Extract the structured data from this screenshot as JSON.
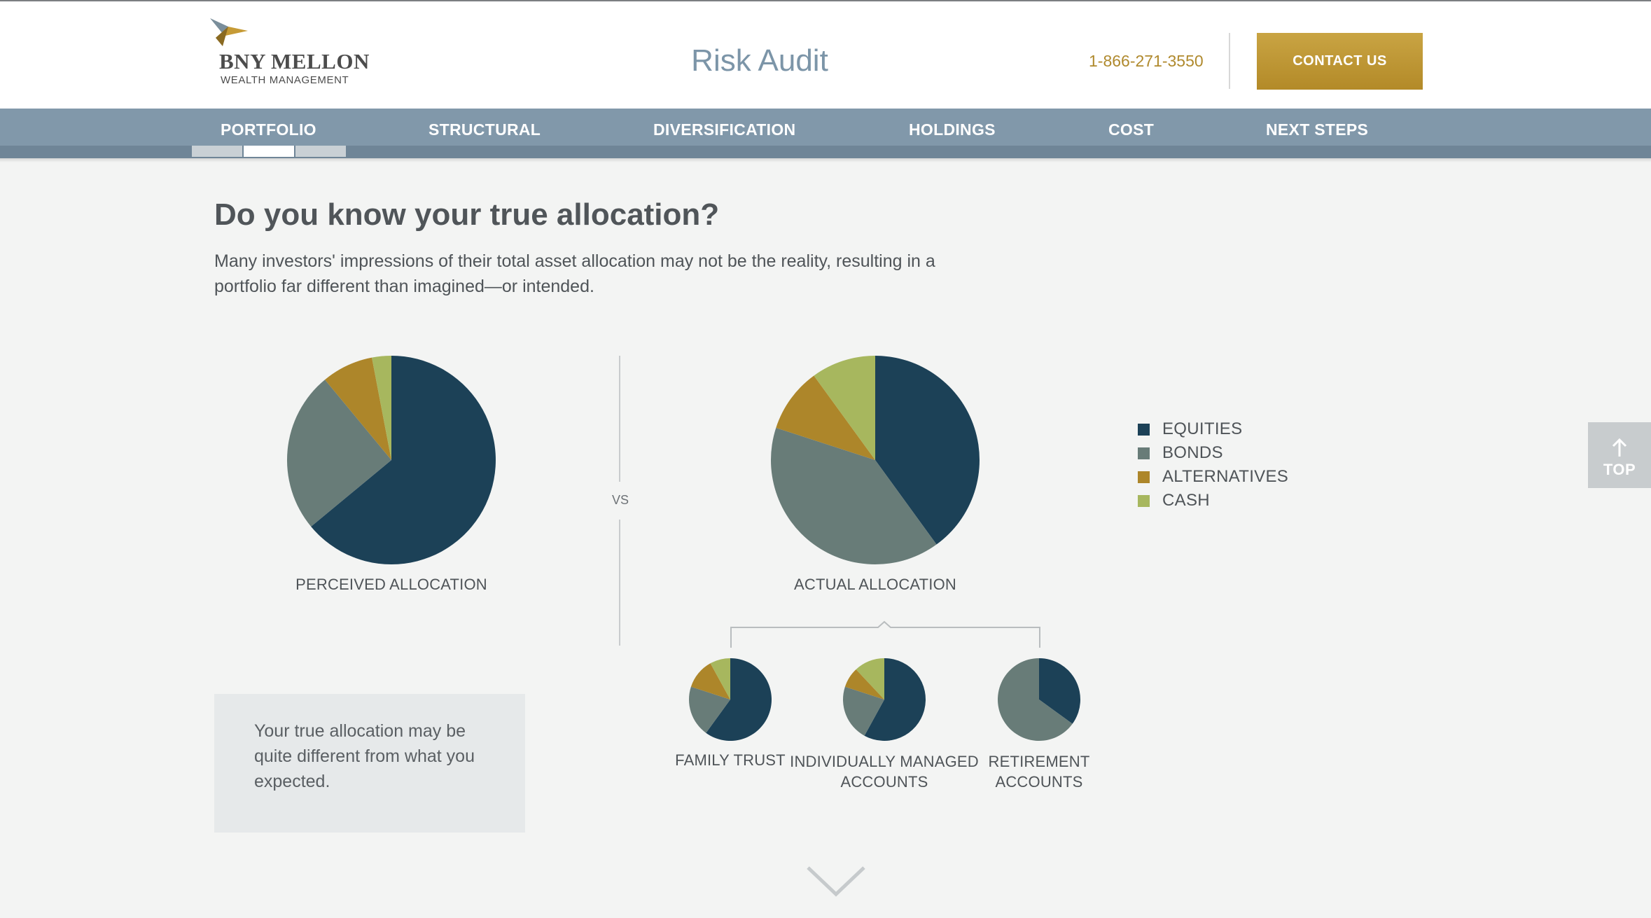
{
  "header": {
    "brand": "BNY MELLON",
    "brand_sub": "WEALTH MANAGEMENT",
    "title": "Risk Audit",
    "phone": "1-866-271-3550",
    "contact_label": "CONTACT US"
  },
  "nav": {
    "items": [
      "PORTFOLIO",
      "STRUCTURAL",
      "DIVERSIFICATION",
      "HOLDINGS",
      "COST",
      "NEXT STEPS"
    ],
    "active_index": 0,
    "progress_segments": 3,
    "progress_active": 1
  },
  "main": {
    "heading": "Do you know your true allocation?",
    "intro": "Many investors' impressions of their total asset allocation may not be the reality, resulting in a portfolio far different than imagined—or intended.",
    "vs_label": "VS",
    "note": "Your true allocation may be quite different from what you expected."
  },
  "colors": {
    "equities": "#1c4157",
    "bonds": "#687c78",
    "alternatives": "#ad862a",
    "cash": "#a7b75e",
    "accent_gold": "#b8902f",
    "nav_bg": "#8198aa"
  },
  "chart_data": [
    {
      "type": "pie",
      "title": "PERCEIVED ALLOCATION",
      "categories": [
        "EQUITIES",
        "BONDS",
        "ALTERNATIVES",
        "CASH"
      ],
      "values": [
        64,
        25,
        8,
        3
      ]
    },
    {
      "type": "pie",
      "title": "ACTUAL ALLOCATION",
      "categories": [
        "EQUITIES",
        "BONDS",
        "ALTERNATIVES",
        "CASH"
      ],
      "values": [
        40,
        40,
        10,
        10
      ]
    },
    {
      "type": "pie",
      "title": "FAMILY TRUST",
      "categories": [
        "EQUITIES",
        "BONDS",
        "ALTERNATIVES",
        "CASH"
      ],
      "values": [
        60,
        20,
        12,
        8
      ]
    },
    {
      "type": "pie",
      "title": "INDIVIDUALLY MANAGED ACCOUNTS",
      "categories": [
        "EQUITIES",
        "BONDS",
        "ALTERNATIVES",
        "CASH"
      ],
      "values": [
        58,
        22,
        8,
        12
      ]
    },
    {
      "type": "pie",
      "title": "RETIREMENT ACCOUNTS",
      "categories": [
        "EQUITIES",
        "BONDS",
        "ALTERNATIVES",
        "CASH"
      ],
      "values": [
        35,
        65,
        0,
        0
      ]
    }
  ],
  "legend": [
    {
      "label": "EQUITIES"
    },
    {
      "label": "BONDS"
    },
    {
      "label": "ALTERNATIVES"
    },
    {
      "label": "CASH"
    }
  ],
  "top_button": {
    "label": "TOP",
    "icon": "arrow-up-icon"
  },
  "scroll_icon": "chevron-down-icon"
}
